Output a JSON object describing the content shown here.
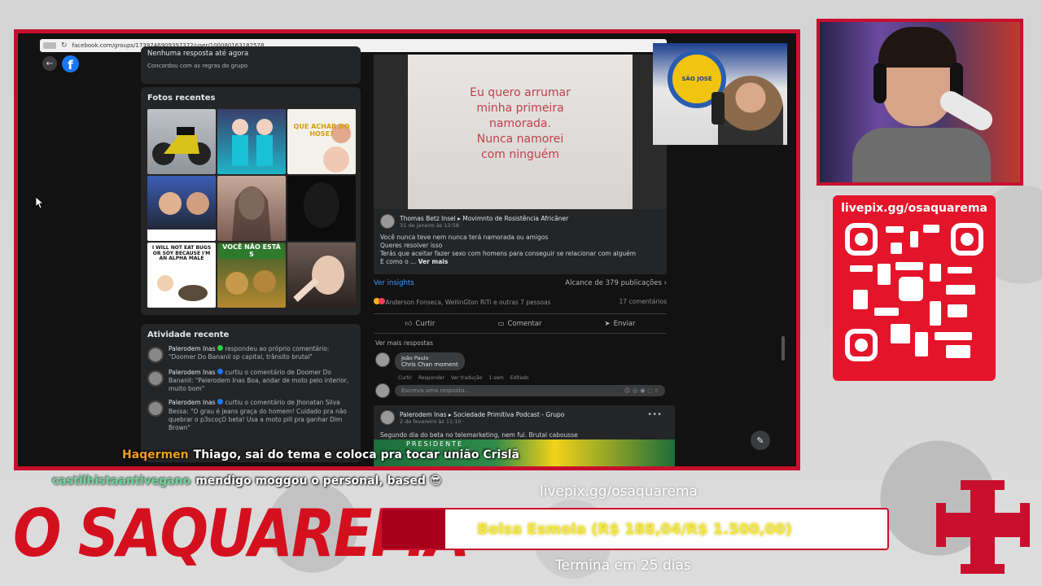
{
  "browser": {
    "url": "facebook.com/groups/1739746909397372/user/100080163182578"
  },
  "facebook": {
    "rules": {
      "line1": "Nenhuma resposta até agora",
      "line2": "Concordou com as regras do grupo"
    },
    "photos_title": "Fotos recentes",
    "photo_captions": [
      "",
      "",
      "QUE ACHAR DO HOSE?",
      "",
      "",
      "",
      "I WILL NOT EAT BUGS OR SOY BECAUSE I'M AN ALPHA MALE",
      "VOCÊ NÃO ESTÁ S",
      ""
    ],
    "activity_title": "Atividade recente",
    "activity": [
      {
        "name": "Palerodem Inas",
        "text": "respondeu ao próprio comentário: \"Doomer Do Bananil sp capital, trânsito brutal\""
      },
      {
        "name": "Palerodem Inas",
        "text": "curtiu o comentário de Doomer Do Bananil: \"Palerodem Inas Boa, andar de moto pelo interior, muito bom\""
      },
      {
        "name": "Palerodem Inas",
        "text": "curtiu o comentário de Jhonatan Silva Bessa: \"O grau é jeans graça do homem! Cuidado pra não quebrar o p3scoçO beta! Usa a moto pill pra ganhar Dim Brown\""
      }
    ],
    "post": {
      "shirt_text": "Eu quero arrumar\nminha primeira\nnamorada.\nNunca namorei\ncom ninguém",
      "author": "Thomas Betz Insel ▸ Movimnto de Rosistência Africâner",
      "date": "31 de janeiro às 13:58 · ",
      "body_lines": [
        "Você nunca teve nem nunca terá namorada ou amigos",
        "Queres resolver isso",
        "Terás que aceitar fazer sexo com homens para conseguir se relacionar com alguém",
        "E como o ... "
      ],
      "see_more": "Ver mais",
      "insights": "Ver insights",
      "reach": "Alcance de 379 publicações",
      "reactions": "Anderson Fonseca, WellinGton RiTi e outras 7 pessoas",
      "comments_count": "17 comentários",
      "like": "Curtir",
      "comment": "Comentar",
      "send": "Enviar",
      "more_replies": "Ver mais respostas",
      "reply_name": "João Paulo",
      "reply_text": "Chris Chan moment",
      "reply_actions": [
        "Curtir",
        "Responder",
        "Ver tradução",
        "1 sem",
        "Editado"
      ],
      "write_placeholder": "Escreva uma resposta..."
    },
    "post2": {
      "author": "Palerodem Inas ▸ Sociedade Primitiva Podcast - Grupo",
      "date": "2 de fevereiro às 11:10 · ",
      "text": "Segundo dia do beta no telemarketing, nem fui. Brutal cabousse",
      "image_text": "PRESIDENTE"
    },
    "inset_logo_text": "SÃO JOSÉ"
  },
  "chat": [
    {
      "user": "Haqermen",
      "message": "Thiago, sai do tema e coloca pra tocar união Crislã"
    },
    {
      "user": "castilhistaantivegano",
      "message": "mendigo moggou o personal, based 😎"
    }
  ],
  "qr": {
    "title": "livepix.gg/osaquarema"
  },
  "brand": "O SAQUAREMA",
  "donation": {
    "url": "livepix.gg/osaquarema",
    "goal_label": "Bolsa Esmola (R$ 188,04/R$ 1.500,00)",
    "raised": 188.04,
    "goal": 1500.0,
    "ends": "Termina em 25 dias"
  },
  "colors": {
    "accent_red": "#c8102e",
    "facebook_blue": "#1877f2",
    "goal_text": "#f2e64a"
  }
}
